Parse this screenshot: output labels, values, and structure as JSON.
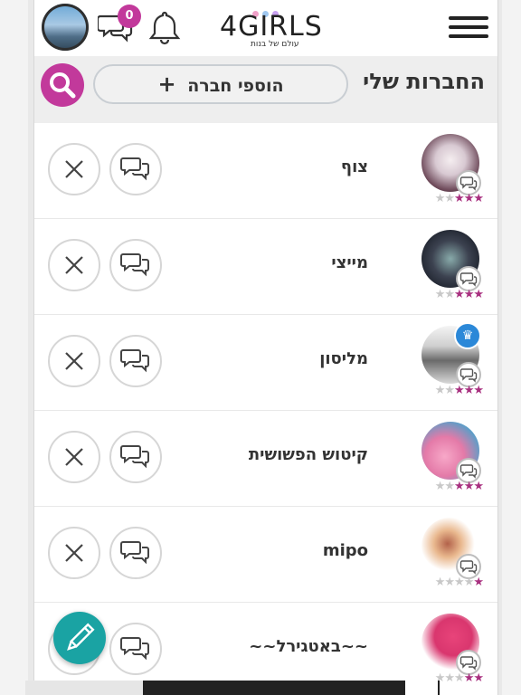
{
  "header": {
    "notification_count": "0",
    "logo": {
      "main": "4GIRLS",
      "tagline": "עולם של בנות"
    },
    "icons": {
      "avatar": "avatar",
      "chat": "chat-icon",
      "bell": "bell-icon",
      "menu": "hamburger-menu-icon"
    }
  },
  "toolbar": {
    "title": "החברות שלי",
    "add_friend_label": "הוספי חברה",
    "add_friend_plus": "+",
    "search_icon": "search-icon"
  },
  "friends": [
    {
      "name": "צוף",
      "stars_on": 3,
      "crown": false
    },
    {
      "name": "מייצי",
      "stars_on": 3,
      "crown": false
    },
    {
      "name": "מליסון",
      "stars_on": 3,
      "crown": true
    },
    {
      "name": "קיטוש הפשושית",
      "stars_on": 3,
      "crown": false
    },
    {
      "name": "mipo",
      "stars_on": 1,
      "crown": false
    },
    {
      "name": "~~באטגירל~~",
      "stars_on": 2,
      "crown": false
    }
  ],
  "colors": {
    "accent": "#c2399b",
    "fab": "#1aa3a3",
    "star_on": "#a8307f",
    "star_off": "#c8c8c8"
  }
}
